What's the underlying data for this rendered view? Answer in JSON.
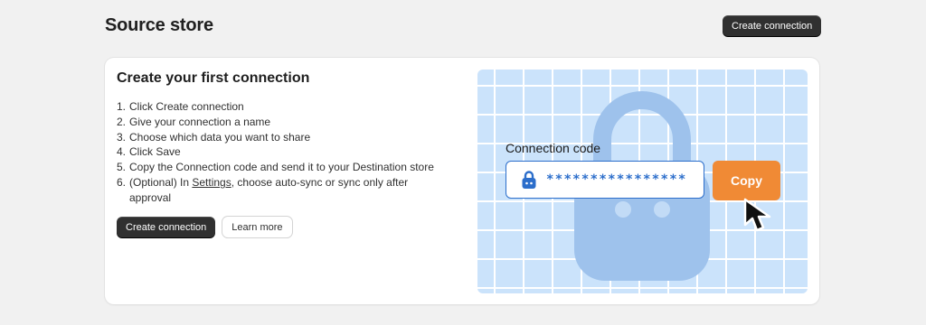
{
  "header": {
    "title": "Source store",
    "create_button_label": "Create connection"
  },
  "card": {
    "title": "Create your first connection",
    "steps": [
      {
        "num": "1.",
        "text": "Click Create connection"
      },
      {
        "num": "2.",
        "text": "Give your connection a name"
      },
      {
        "num": "3.",
        "text": "Choose which data you want to share"
      },
      {
        "num": "4.",
        "text": "Click Save"
      },
      {
        "num": "5.",
        "text": "Copy the Connection code and send it to your Destination store"
      },
      {
        "num": "6.",
        "text_before": "(Optional) In ",
        "link": "Settings",
        "text_after": ", choose auto-sync or sync only after approval"
      }
    ],
    "primary_button_label": "Create connection",
    "secondary_button_label": "Learn more"
  },
  "illustration": {
    "code_label": "Connection code",
    "masked_code": "****************",
    "copy_button_label": "Copy",
    "icons": [
      "lock-icon",
      "cursor-icon"
    ],
    "colors": {
      "background": "#cbe3fb",
      "accent_blue": "#2c6ecb",
      "copy_orange": "#f08a35",
      "lock_silhouette": "#9ec2ec"
    }
  }
}
